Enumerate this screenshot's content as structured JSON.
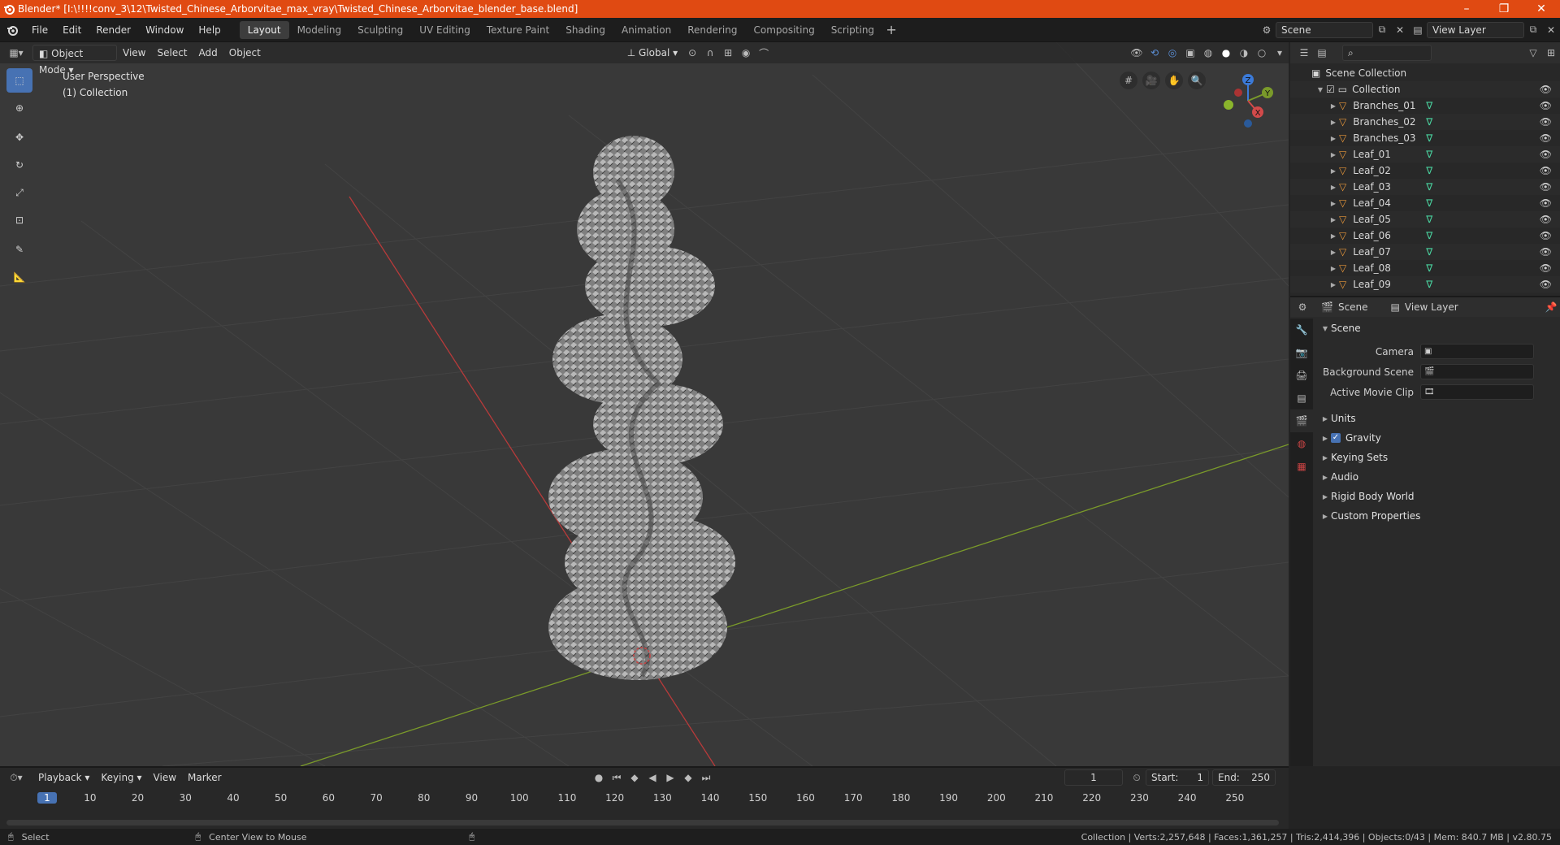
{
  "titlebar": {
    "title": "Blender* [I:\\!!!!conv_3\\12\\Twisted_Chinese_Arborvitae_max_vray\\Twisted_Chinese_Arborvitae_blender_base.blend]"
  },
  "menu": [
    "File",
    "Edit",
    "Render",
    "Window",
    "Help"
  ],
  "workspaces": [
    "Layout",
    "Modeling",
    "Sculpting",
    "UV Editing",
    "Texture Paint",
    "Shading",
    "Animation",
    "Rendering",
    "Compositing",
    "Scripting"
  ],
  "active_workspace": "Layout",
  "scene_field": "Scene",
  "view_layer_field": "View Layer",
  "viewport": {
    "mode": "Object Mode",
    "menus": [
      "View",
      "Select",
      "Add",
      "Object"
    ],
    "orientation": "Global",
    "overlay_line1": "User Perspective",
    "overlay_line2": "(1) Collection",
    "gizmo_axes": {
      "x": "X",
      "y": "Y",
      "z": "Z"
    }
  },
  "outliner": {
    "root": "Scene Collection",
    "collection": "Collection",
    "items": [
      "Branches_01",
      "Branches_02",
      "Branches_03",
      "Leaf_01",
      "Leaf_02",
      "Leaf_03",
      "Leaf_04",
      "Leaf_05",
      "Leaf_06",
      "Leaf_07",
      "Leaf_08",
      "Leaf_09"
    ]
  },
  "properties": {
    "breadcrumb_scene": "Scene",
    "breadcrumb_layer": "View Layer",
    "panel_title": "Scene",
    "rows": [
      {
        "label": "Camera"
      },
      {
        "label": "Background Scene"
      },
      {
        "label": "Active Movie Clip"
      }
    ],
    "subpanels": [
      "Units",
      "Gravity",
      "Keying Sets",
      "Audio",
      "Rigid Body World",
      "Custom Properties"
    ],
    "gravity_checked": true
  },
  "timeline": {
    "menus": [
      "Playback",
      "Keying",
      "View",
      "Marker"
    ],
    "current_frame": "1",
    "start_label": "Start:",
    "start": "1",
    "end_label": "End:",
    "end": "250",
    "ticks": [
      "1",
      "10",
      "20",
      "30",
      "40",
      "50",
      "60",
      "70",
      "80",
      "90",
      "100",
      "110",
      "120",
      "130",
      "140",
      "150",
      "160",
      "170",
      "180",
      "190",
      "200",
      "210",
      "220",
      "230",
      "240",
      "250"
    ]
  },
  "statusbar": {
    "left1": "Select",
    "left2": "Center View to Mouse",
    "stats": "Collection | Verts:2,257,648 | Faces:1,361,257 | Tris:2,414,396 | Objects:0/43 | Mem: 840.7 MB | v2.80.75"
  },
  "colors": {
    "accent": "#4772b3",
    "title_bar": "#e04a12",
    "x_axis": "#b83a3a",
    "y_axis": "#7a9a2a"
  }
}
